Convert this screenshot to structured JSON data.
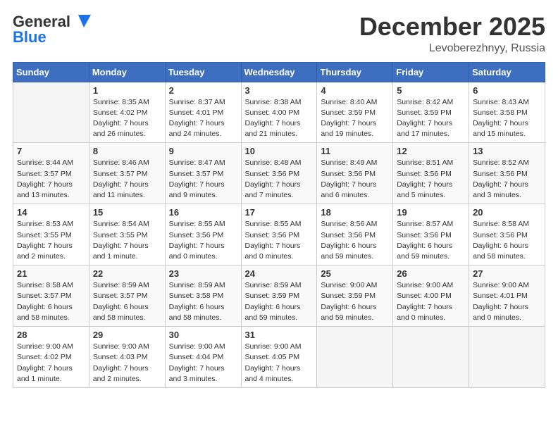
{
  "header": {
    "logo_line1": "General",
    "logo_line2": "Blue",
    "month": "December 2025",
    "location": "Levoberezhnyy, Russia"
  },
  "days_of_week": [
    "Sunday",
    "Monday",
    "Tuesday",
    "Wednesday",
    "Thursday",
    "Friday",
    "Saturday"
  ],
  "weeks": [
    [
      {
        "day": "",
        "info": ""
      },
      {
        "day": "1",
        "info": "Sunrise: 8:35 AM\nSunset: 4:02 PM\nDaylight: 7 hours\nand 26 minutes."
      },
      {
        "day": "2",
        "info": "Sunrise: 8:37 AM\nSunset: 4:01 PM\nDaylight: 7 hours\nand 24 minutes."
      },
      {
        "day": "3",
        "info": "Sunrise: 8:38 AM\nSunset: 4:00 PM\nDaylight: 7 hours\nand 21 minutes."
      },
      {
        "day": "4",
        "info": "Sunrise: 8:40 AM\nSunset: 3:59 PM\nDaylight: 7 hours\nand 19 minutes."
      },
      {
        "day": "5",
        "info": "Sunrise: 8:42 AM\nSunset: 3:59 PM\nDaylight: 7 hours\nand 17 minutes."
      },
      {
        "day": "6",
        "info": "Sunrise: 8:43 AM\nSunset: 3:58 PM\nDaylight: 7 hours\nand 15 minutes."
      }
    ],
    [
      {
        "day": "7",
        "info": "Sunrise: 8:44 AM\nSunset: 3:57 PM\nDaylight: 7 hours\nand 13 minutes."
      },
      {
        "day": "8",
        "info": "Sunrise: 8:46 AM\nSunset: 3:57 PM\nDaylight: 7 hours\nand 11 minutes."
      },
      {
        "day": "9",
        "info": "Sunrise: 8:47 AM\nSunset: 3:57 PM\nDaylight: 7 hours\nand 9 minutes."
      },
      {
        "day": "10",
        "info": "Sunrise: 8:48 AM\nSunset: 3:56 PM\nDaylight: 7 hours\nand 7 minutes."
      },
      {
        "day": "11",
        "info": "Sunrise: 8:49 AM\nSunset: 3:56 PM\nDaylight: 7 hours\nand 6 minutes."
      },
      {
        "day": "12",
        "info": "Sunrise: 8:51 AM\nSunset: 3:56 PM\nDaylight: 7 hours\nand 5 minutes."
      },
      {
        "day": "13",
        "info": "Sunrise: 8:52 AM\nSunset: 3:56 PM\nDaylight: 7 hours\nand 3 minutes."
      }
    ],
    [
      {
        "day": "14",
        "info": "Sunrise: 8:53 AM\nSunset: 3:55 PM\nDaylight: 7 hours\nand 2 minutes."
      },
      {
        "day": "15",
        "info": "Sunrise: 8:54 AM\nSunset: 3:55 PM\nDaylight: 7 hours\nand 1 minute."
      },
      {
        "day": "16",
        "info": "Sunrise: 8:55 AM\nSunset: 3:56 PM\nDaylight: 7 hours\nand 0 minutes."
      },
      {
        "day": "17",
        "info": "Sunrise: 8:55 AM\nSunset: 3:56 PM\nDaylight: 7 hours\nand 0 minutes."
      },
      {
        "day": "18",
        "info": "Sunrise: 8:56 AM\nSunset: 3:56 PM\nDaylight: 6 hours\nand 59 minutes."
      },
      {
        "day": "19",
        "info": "Sunrise: 8:57 AM\nSunset: 3:56 PM\nDaylight: 6 hours\nand 59 minutes."
      },
      {
        "day": "20",
        "info": "Sunrise: 8:58 AM\nSunset: 3:56 PM\nDaylight: 6 hours\nand 58 minutes."
      }
    ],
    [
      {
        "day": "21",
        "info": "Sunrise: 8:58 AM\nSunset: 3:57 PM\nDaylight: 6 hours\nand 58 minutes."
      },
      {
        "day": "22",
        "info": "Sunrise: 8:59 AM\nSunset: 3:57 PM\nDaylight: 6 hours\nand 58 minutes."
      },
      {
        "day": "23",
        "info": "Sunrise: 8:59 AM\nSunset: 3:58 PM\nDaylight: 6 hours\nand 58 minutes."
      },
      {
        "day": "24",
        "info": "Sunrise: 8:59 AM\nSunset: 3:59 PM\nDaylight: 6 hours\nand 59 minutes."
      },
      {
        "day": "25",
        "info": "Sunrise: 9:00 AM\nSunset: 3:59 PM\nDaylight: 6 hours\nand 59 minutes."
      },
      {
        "day": "26",
        "info": "Sunrise: 9:00 AM\nSunset: 4:00 PM\nDaylight: 7 hours\nand 0 minutes."
      },
      {
        "day": "27",
        "info": "Sunrise: 9:00 AM\nSunset: 4:01 PM\nDaylight: 7 hours\nand 0 minutes."
      }
    ],
    [
      {
        "day": "28",
        "info": "Sunrise: 9:00 AM\nSunset: 4:02 PM\nDaylight: 7 hours\nand 1 minute."
      },
      {
        "day": "29",
        "info": "Sunrise: 9:00 AM\nSunset: 4:03 PM\nDaylight: 7 hours\nand 2 minutes."
      },
      {
        "day": "30",
        "info": "Sunrise: 9:00 AM\nSunset: 4:04 PM\nDaylight: 7 hours\nand 3 minutes."
      },
      {
        "day": "31",
        "info": "Sunrise: 9:00 AM\nSunset: 4:05 PM\nDaylight: 7 hours\nand 4 minutes."
      },
      {
        "day": "",
        "info": ""
      },
      {
        "day": "",
        "info": ""
      },
      {
        "day": "",
        "info": ""
      }
    ]
  ]
}
